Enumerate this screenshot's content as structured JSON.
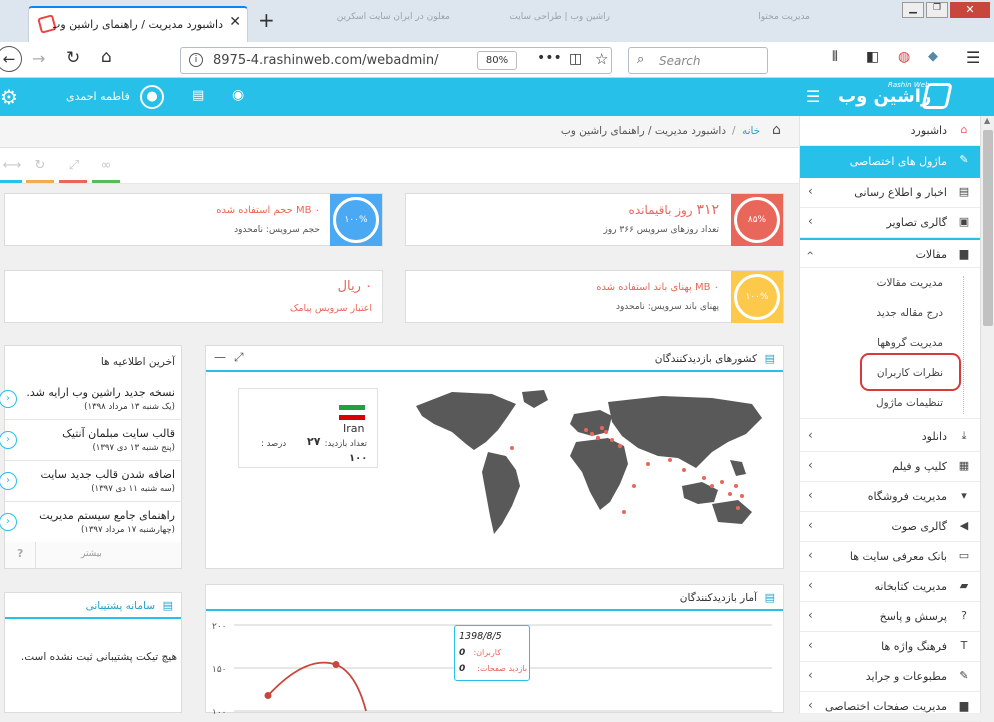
{
  "browser": {
    "tab_title": "داشبورد مدیریت / راهنمای راشین وب",
    "bg_tabs": [
      "معلون در ایران سایت اسکرین",
      "راشین وب | طراحی سایت",
      "مدیریت محتوا"
    ],
    "url": "8975-4.rashinweb.com/webadmin/",
    "zoom": "80%",
    "search_placeholder": "Search"
  },
  "header": {
    "logo_text": "راشین وب",
    "logo_sub": "Rashin Web",
    "user_name": "فاطمه احمدی"
  },
  "breadcrumb": {
    "home": "خانه",
    "sep": "/",
    "current": "داشبورد مدیریت / راهنمای راشین وب"
  },
  "sidebar": {
    "dashboard": "داشبورد",
    "special_modules": "ماژول های اختصاصی",
    "items_top": [
      {
        "label": "اخبار و اطلاع رسانی",
        "icon": "newspaper-icon"
      },
      {
        "label": "گالری تصاویر",
        "icon": "image-icon"
      }
    ],
    "articles": "مقالات",
    "article_subitems": [
      "مدیریت مقالات",
      "درج مقاله جدید",
      "مدیریت گروهها",
      "نظرات کاربران",
      "تنظیمات ماژول"
    ],
    "items_bottom": [
      {
        "label": "دانلود",
        "icon": "download-icon"
      },
      {
        "label": "کلیپ و فیلم",
        "icon": "film-icon"
      },
      {
        "label": "مدیریت فروشگاه",
        "icon": "cart-icon"
      },
      {
        "label": "گالری صوت",
        "icon": "speaker-icon"
      },
      {
        "label": "بانک معرفی سایت ها",
        "icon": "monitor-icon"
      },
      {
        "label": "مدیریت کتابخانه",
        "icon": "book-icon"
      },
      {
        "label": "پرسش و پاسخ",
        "icon": "question-icon"
      },
      {
        "label": "فرهنگ واژه ها",
        "icon": "text-icon"
      },
      {
        "label": "مطبوعات و جراید",
        "icon": "pin-icon"
      },
      {
        "label": "مدیریت صفحات اختصاصی",
        "icon": "file-icon"
      }
    ]
  },
  "stats": {
    "days_left": {
      "value": "۳۱۲",
      "label": "روز باقیمانده",
      "sub": "تعداد روزهای سرویس ۳۶۶ روز",
      "percent": "۸۵%",
      "color": "#e9675a"
    },
    "disk": {
      "value": "۰",
      "label": "MB حجم استفاده شده",
      "sub": "حجم سرویس: نامحدود",
      "percent": "۱۰۰%",
      "color": "#4ba8f3"
    },
    "bandwidth": {
      "value": "۰",
      "label": "MB پهنای باند استفاده شده",
      "sub": "پهنای باند سرویس: نامحدود",
      "percent": "۱۰۰%",
      "color": "#fcc94a"
    },
    "sms": {
      "value": "۰",
      "label": "ریال",
      "sub": "اعتبار سرویس پیامک"
    }
  },
  "countries_panel": {
    "title": "کشورهای بازدیدکنندگان",
    "country": "Iran",
    "visits_label": "تعداد بازدید:",
    "visits_value": "۲۷",
    "percent_label": "درصد :",
    "percent_value": "۱۰۰"
  },
  "news_panel": {
    "title": "آخرین اطلاعیه ها",
    "items": [
      {
        "title": "نسخه جدید راشین وب ارایه شد.",
        "date": "(یک شنبه ۱۳ مرداد ۱۳۹۸)"
      },
      {
        "title": "قالب سایت مبلمان آنتیک",
        "date": "(پنج شنبه ۱۳ دی ۱۳۹۷)"
      },
      {
        "title": "اضافه شدن قالب جدید سایت",
        "date": "(سه شنبه ۱۱ دی ۱۳۹۷)"
      },
      {
        "title": "راهنمای جامع سیستم مدیریت",
        "date": "(چهارشنبه ۱۷ مرداد ۱۳۹۷)"
      }
    ],
    "more": "بیشتر",
    "help": "?"
  },
  "support_panel": {
    "title": "سامانه پشتیبانی",
    "empty": "هیچ تیکت پشتیبانی ثبت نشده است."
  },
  "visits_panel": {
    "title": "آمار بازدیدکنندگان",
    "tooltip_date": "1398/8/5",
    "tooltip_users_label": "کاربران:",
    "tooltip_users_value": "0",
    "tooltip_pages_label": "بازدید صفحات:",
    "tooltip_pages_value": "0"
  },
  "chart_data": {
    "type": "line",
    "y_ticks": [
      "۲۰۰",
      "۱۵۰",
      "۱۰۰"
    ],
    "ylim": [
      100,
      200
    ],
    "series": [
      {
        "values": [
          118,
          154,
          100
        ]
      }
    ]
  },
  "colors": {
    "accent": "#27c0e9",
    "red": "#e9675a",
    "blue": "#4ba8f3",
    "yellow": "#fcc94a",
    "green": "#5cb85c",
    "orange": "#f0ad4e"
  }
}
